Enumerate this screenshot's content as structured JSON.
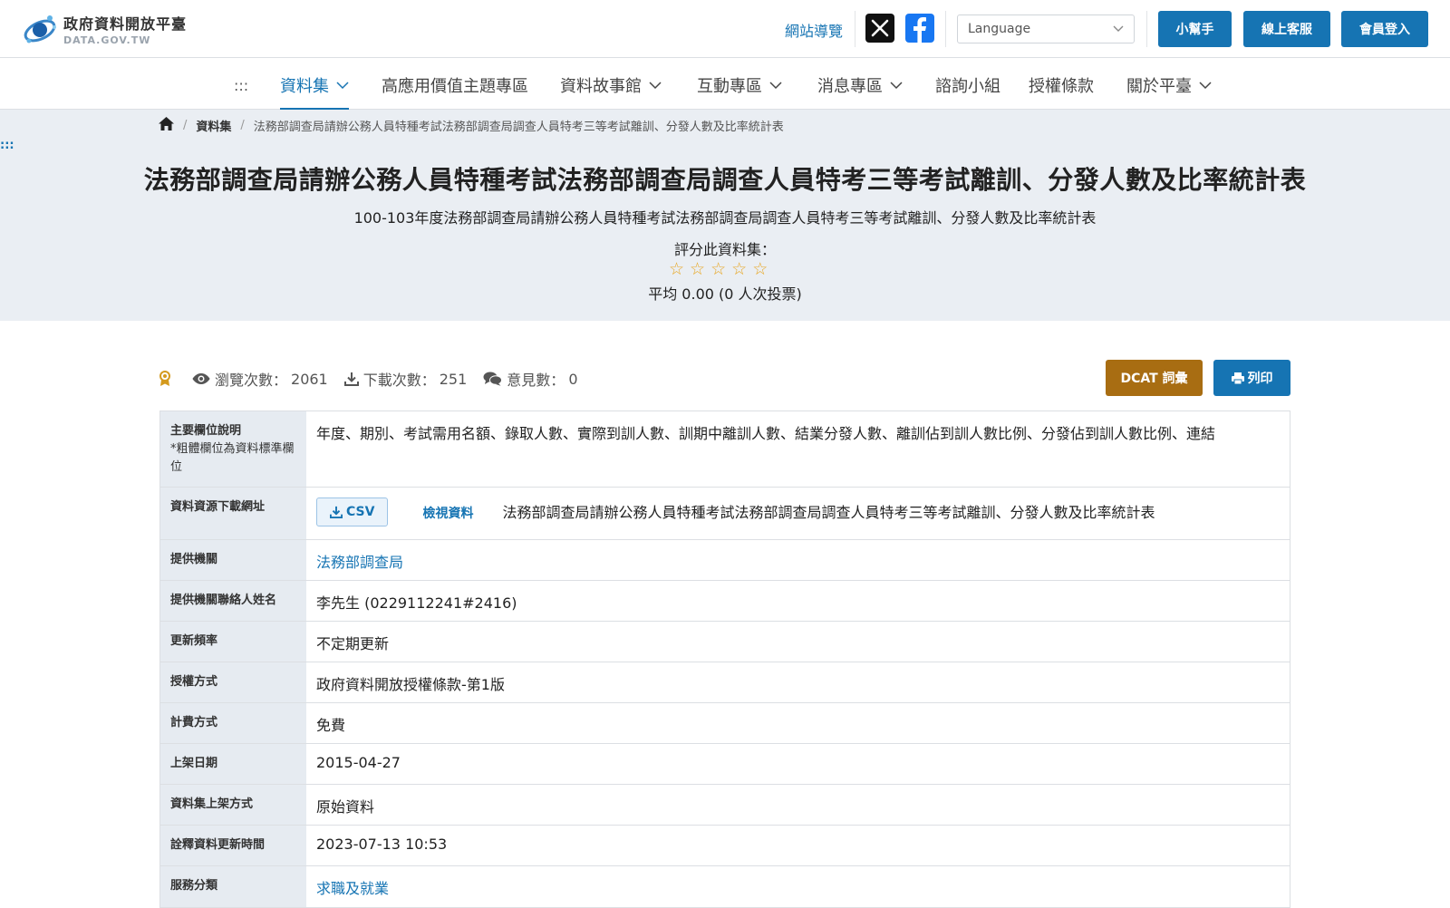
{
  "header": {
    "logo_title": "政府資料開放平臺",
    "logo_sub": "DATA.GOV.TW",
    "sitemap": "網站導覽",
    "language_placeholder": "Language",
    "buttons": {
      "helper": "小幫手",
      "support": "線上客服",
      "login": "會員登入"
    }
  },
  "nav": {
    "skip": ":::",
    "items": [
      {
        "label": "資料集"
      },
      {
        "label": "高應用價值主題專區"
      },
      {
        "label": "資料故事館"
      },
      {
        "label": "互動專區"
      },
      {
        "label": "消息專區"
      },
      {
        "label": "諮詢小組"
      },
      {
        "label": "授權條款"
      },
      {
        "label": "關於平臺"
      }
    ]
  },
  "breadcrumb": {
    "level1": "資料集",
    "current": "法務部調查局請辦公務人員特種考試法務部調查局調查人員特考三等考試離訓、分發人數及比率統計表"
  },
  "skip_dots": ":::",
  "hero": {
    "title": "法務部調查局請辦公務人員特種考試法務部調查局調查人員特考三等考試離訓、分發人數及比率統計表",
    "subtitle": "100-103年度法務部調查局請辦公務人員特種考試法務部調查局調查人員特考三等考試離訓、分發人數及比率統計表",
    "rate_label": "評分此資料集：",
    "rating_value": 0,
    "rating_max": 5,
    "rate_avg": "平均 0.00 (0 人次投票)"
  },
  "stats": {
    "views_label": "瀏覽次數：",
    "views": "2061",
    "downloads_label": "下載次數：",
    "downloads": "251",
    "comments_label": "意見數：",
    "comments": "0"
  },
  "actions": {
    "dcat": "DCAT 詞彙",
    "print": "列印"
  },
  "table": {
    "main_fields_label": "主要欄位說明",
    "main_fields_note": "*粗體欄位為資料標準欄位",
    "main_fields": "年度、期別、考試需用名額、錄取人數、實際到訓人數、訓期中離訓人數、結業分發人數、離訓佔到訓人數比例、分發佔到訓人數比例、連結",
    "resource_label": "資料資源下載網址",
    "resource_format": "CSV",
    "resource_view": "檢視資料",
    "resource_name": "法務部調查局請辦公務人員特種考試法務部調查局調查人員特考三等考試離訓、分發人數及比率統計表",
    "provider_label": "提供機關",
    "provider": "法務部調查局",
    "contact_label": "提供機關聯絡人姓名",
    "contact": "李先生 (0229112241#2416)",
    "frequency_label": "更新頻率",
    "frequency": "不定期更新",
    "license_label": "授權方式",
    "license": "政府資料開放授權條款-第1版",
    "fee_label": "計費方式",
    "fee": "免費",
    "publish_label": "上架日期",
    "publish": "2015-04-27",
    "method_label": "資料集上架方式",
    "method": "原始資料",
    "meta_updated_label": "詮釋資料更新時間",
    "meta_updated": "2023-07-13 10:53",
    "category_label": "服務分類",
    "category": "求職及就業"
  }
}
